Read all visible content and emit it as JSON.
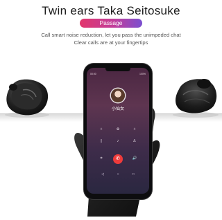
{
  "header": {
    "title": "Twin ears Taka Seitosuke",
    "badge": "Passage",
    "subtitle_line1": "Call smart noise reduction, let you pass the unimpeded chat",
    "subtitle_line2": "Clear calls are at your fingertips"
  },
  "phone": {
    "status_left": "00:00",
    "status_right": "100%",
    "caller_name": "小仙女",
    "call_row1": [
      "+",
      "⊕",
      "+"
    ],
    "call_row2": [
      "▯",
      "♪",
      "♙"
    ],
    "call_row3": [
      "⌗",
      "",
      "🔊"
    ],
    "end_call_icon": "phone-hangup-icon",
    "nav_icons": [
      "back-icon",
      "home-icon",
      "recent-icon"
    ]
  },
  "colors": {
    "badge_start": "#e2376d",
    "badge_end": "#7a4fd0",
    "end_call": "#ef3b3b"
  }
}
